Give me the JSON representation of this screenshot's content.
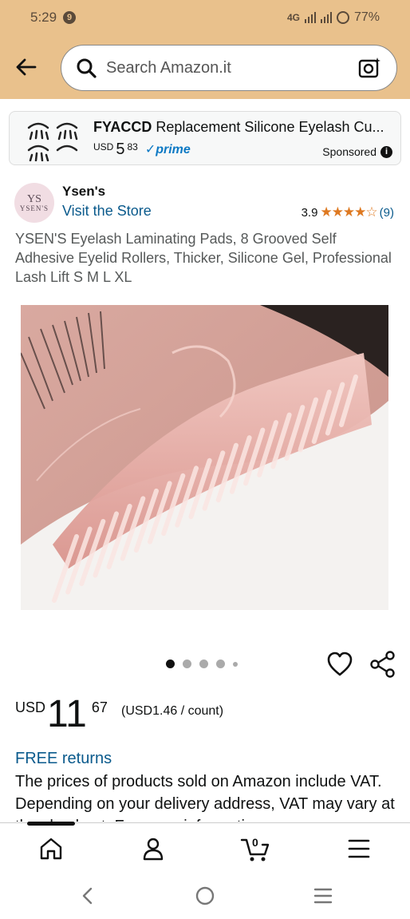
{
  "status_bar": {
    "time": "5:29",
    "notification_count": "9",
    "network": "4G",
    "battery": "77%"
  },
  "search": {
    "placeholder": "Search Amazon.it"
  },
  "sponsored_ad": {
    "brand": "FYACCD",
    "title_rest": " Replacement Silicone Eyelash Cu...",
    "currency": "USD",
    "price_whole": "5",
    "price_fraction": "83",
    "prime_label": "prime",
    "sponsored_label": "Sponsored"
  },
  "brand": {
    "logo_line1": "YS",
    "logo_line2": "YSEN'S",
    "name": "Ysen's",
    "visit_store": "Visit the Store"
  },
  "rating": {
    "value": "3.9",
    "stars_filled": 4,
    "stars_total": 5,
    "count": "(9)"
  },
  "product": {
    "title": "YSEN'S Eyelash Laminating Pads, 8 Grooved Self Adhesive Eyelid Rollers, Thicker, Silicone Gel, Professional Lash Lift S M L XL"
  },
  "gallery": {
    "image_count": 5,
    "active_index": 0
  },
  "price": {
    "currency": "USD",
    "whole": "11",
    "fraction": "67",
    "unit_price": "(USD1.46 / count)"
  },
  "returns": {
    "label": "FREE returns"
  },
  "vat_notice": "The prices of products sold on Amazon include VAT. Depending on your delivery address, VAT may vary at the checkout. For more information",
  "bottom_nav": {
    "items": [
      "home-icon",
      "account-icon",
      "cart-icon",
      "menu-icon"
    ],
    "cart_count": "0"
  },
  "colors": {
    "header_bg": "#e9c18c",
    "link": "#0a5a8c",
    "star": "#de7921",
    "prime": "#0d79c4"
  }
}
